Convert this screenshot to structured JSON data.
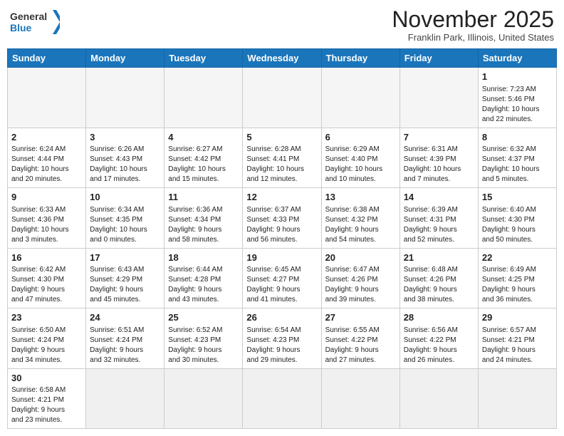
{
  "header": {
    "logo_general": "General",
    "logo_blue": "Blue",
    "month_title": "November 2025",
    "location": "Franklin Park, Illinois, United States"
  },
  "weekdays": [
    "Sunday",
    "Monday",
    "Tuesday",
    "Wednesday",
    "Thursday",
    "Friday",
    "Saturday"
  ],
  "weeks": [
    [
      {
        "day": "",
        "info": ""
      },
      {
        "day": "",
        "info": ""
      },
      {
        "day": "",
        "info": ""
      },
      {
        "day": "",
        "info": ""
      },
      {
        "day": "",
        "info": ""
      },
      {
        "day": "",
        "info": ""
      },
      {
        "day": "1",
        "info": "Sunrise: 7:23 AM\nSunset: 5:46 PM\nDaylight: 10 hours\nand 22 minutes."
      }
    ],
    [
      {
        "day": "2",
        "info": "Sunrise: 6:24 AM\nSunset: 4:44 PM\nDaylight: 10 hours\nand 20 minutes."
      },
      {
        "day": "3",
        "info": "Sunrise: 6:26 AM\nSunset: 4:43 PM\nDaylight: 10 hours\nand 17 minutes."
      },
      {
        "day": "4",
        "info": "Sunrise: 6:27 AM\nSunset: 4:42 PM\nDaylight: 10 hours\nand 15 minutes."
      },
      {
        "day": "5",
        "info": "Sunrise: 6:28 AM\nSunset: 4:41 PM\nDaylight: 10 hours\nand 12 minutes."
      },
      {
        "day": "6",
        "info": "Sunrise: 6:29 AM\nSunset: 4:40 PM\nDaylight: 10 hours\nand 10 minutes."
      },
      {
        "day": "7",
        "info": "Sunrise: 6:31 AM\nSunset: 4:39 PM\nDaylight: 10 hours\nand 7 minutes."
      },
      {
        "day": "8",
        "info": "Sunrise: 6:32 AM\nSunset: 4:37 PM\nDaylight: 10 hours\nand 5 minutes."
      }
    ],
    [
      {
        "day": "9",
        "info": "Sunrise: 6:33 AM\nSunset: 4:36 PM\nDaylight: 10 hours\nand 3 minutes."
      },
      {
        "day": "10",
        "info": "Sunrise: 6:34 AM\nSunset: 4:35 PM\nDaylight: 10 hours\nand 0 minutes."
      },
      {
        "day": "11",
        "info": "Sunrise: 6:36 AM\nSunset: 4:34 PM\nDaylight: 9 hours\nand 58 minutes."
      },
      {
        "day": "12",
        "info": "Sunrise: 6:37 AM\nSunset: 4:33 PM\nDaylight: 9 hours\nand 56 minutes."
      },
      {
        "day": "13",
        "info": "Sunrise: 6:38 AM\nSunset: 4:32 PM\nDaylight: 9 hours\nand 54 minutes."
      },
      {
        "day": "14",
        "info": "Sunrise: 6:39 AM\nSunset: 4:31 PM\nDaylight: 9 hours\nand 52 minutes."
      },
      {
        "day": "15",
        "info": "Sunrise: 6:40 AM\nSunset: 4:30 PM\nDaylight: 9 hours\nand 50 minutes."
      }
    ],
    [
      {
        "day": "16",
        "info": "Sunrise: 6:42 AM\nSunset: 4:30 PM\nDaylight: 9 hours\nand 47 minutes."
      },
      {
        "day": "17",
        "info": "Sunrise: 6:43 AM\nSunset: 4:29 PM\nDaylight: 9 hours\nand 45 minutes."
      },
      {
        "day": "18",
        "info": "Sunrise: 6:44 AM\nSunset: 4:28 PM\nDaylight: 9 hours\nand 43 minutes."
      },
      {
        "day": "19",
        "info": "Sunrise: 6:45 AM\nSunset: 4:27 PM\nDaylight: 9 hours\nand 41 minutes."
      },
      {
        "day": "20",
        "info": "Sunrise: 6:47 AM\nSunset: 4:26 PM\nDaylight: 9 hours\nand 39 minutes."
      },
      {
        "day": "21",
        "info": "Sunrise: 6:48 AM\nSunset: 4:26 PM\nDaylight: 9 hours\nand 38 minutes."
      },
      {
        "day": "22",
        "info": "Sunrise: 6:49 AM\nSunset: 4:25 PM\nDaylight: 9 hours\nand 36 minutes."
      }
    ],
    [
      {
        "day": "23",
        "info": "Sunrise: 6:50 AM\nSunset: 4:24 PM\nDaylight: 9 hours\nand 34 minutes."
      },
      {
        "day": "24",
        "info": "Sunrise: 6:51 AM\nSunset: 4:24 PM\nDaylight: 9 hours\nand 32 minutes."
      },
      {
        "day": "25",
        "info": "Sunrise: 6:52 AM\nSunset: 4:23 PM\nDaylight: 9 hours\nand 30 minutes."
      },
      {
        "day": "26",
        "info": "Sunrise: 6:54 AM\nSunset: 4:23 PM\nDaylight: 9 hours\nand 29 minutes."
      },
      {
        "day": "27",
        "info": "Sunrise: 6:55 AM\nSunset: 4:22 PM\nDaylight: 9 hours\nand 27 minutes."
      },
      {
        "day": "28",
        "info": "Sunrise: 6:56 AM\nSunset: 4:22 PM\nDaylight: 9 hours\nand 26 minutes."
      },
      {
        "day": "29",
        "info": "Sunrise: 6:57 AM\nSunset: 4:21 PM\nDaylight: 9 hours\nand 24 minutes."
      }
    ],
    [
      {
        "day": "30",
        "info": "Sunrise: 6:58 AM\nSunset: 4:21 PM\nDaylight: 9 hours\nand 23 minutes."
      },
      {
        "day": "",
        "info": ""
      },
      {
        "day": "",
        "info": ""
      },
      {
        "day": "",
        "info": ""
      },
      {
        "day": "",
        "info": ""
      },
      {
        "day": "",
        "info": ""
      },
      {
        "day": "",
        "info": ""
      }
    ]
  ]
}
